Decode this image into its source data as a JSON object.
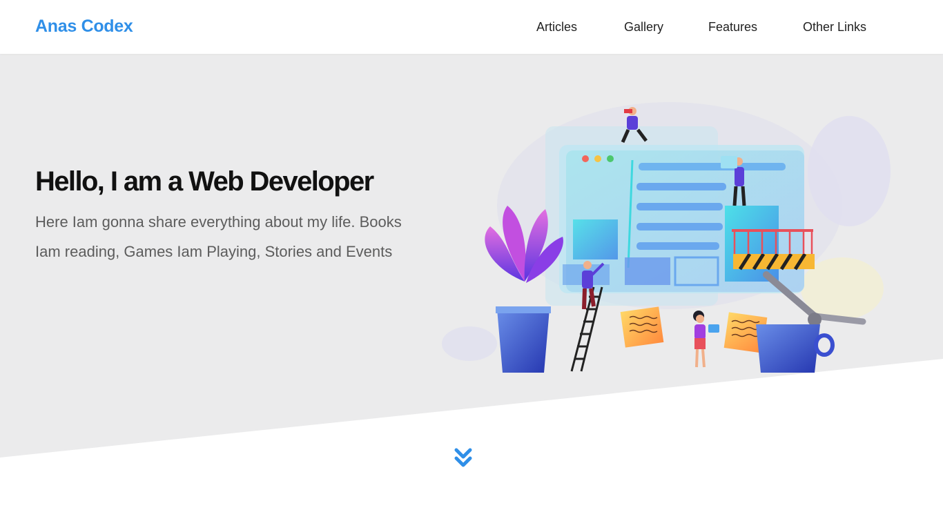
{
  "navbar": {
    "brand": "Anas Codex",
    "links": [
      {
        "label": "Articles"
      },
      {
        "label": "Gallery"
      },
      {
        "label": "Features"
      },
      {
        "label": "Other Links"
      }
    ]
  },
  "hero": {
    "title": "Hello, I am a Web Developer",
    "description": "Here Iam gonna share everything about my life. Books Iam reading, Games Iam Playing, Stories and Events",
    "illustration_icon": "web-development-team-illustration",
    "scroll_icon": "double-chevron-down-icon"
  },
  "colors": {
    "brand": "#2f8fe8",
    "hero_background": "#ebebec",
    "accent": "#2f8fe8"
  }
}
